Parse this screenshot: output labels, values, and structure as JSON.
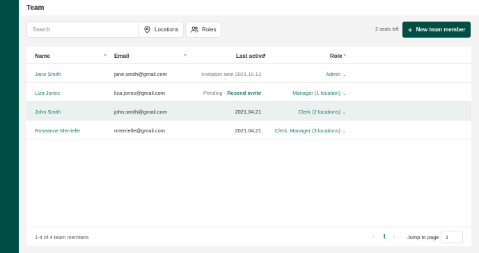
{
  "header": {
    "title": "Team"
  },
  "toolbar": {
    "search_placeholder": "Search",
    "locations_label": "Locations",
    "roles_label": "Roles",
    "seats_left": "2 seats left",
    "new_member_label": "New team member"
  },
  "table": {
    "columns": {
      "name": "Name",
      "email": "Email",
      "last_active": "Last active",
      "role": "Role"
    },
    "rows": [
      {
        "name": "Jane Smith",
        "email": "jane.smith@gmail.com",
        "last_active": "Invitation sent 2021.10.13",
        "role": "Admin"
      },
      {
        "name": "Liza Jones",
        "email": "liza.jones@gmail.com",
        "last_active_prefix": "Pending - ",
        "last_active_link": "Resend invite",
        "role": "Manager (1 location)"
      },
      {
        "name": "John Smith",
        "email": "john.smith@gmail.com",
        "last_active": "2021.04.21",
        "role": "Clerk (2 locations)",
        "selected": true
      },
      {
        "name": "Roseanne Merrielle",
        "email": "rmerrielle@gmail.com",
        "last_active": "2021.04.21",
        "role": "Clerk, Manager (3 locations)"
      }
    ]
  },
  "footer": {
    "count_text": "1-4 of 4 team members",
    "current_page": "1",
    "jump_label": "Jump to page",
    "jump_value": "1"
  }
}
